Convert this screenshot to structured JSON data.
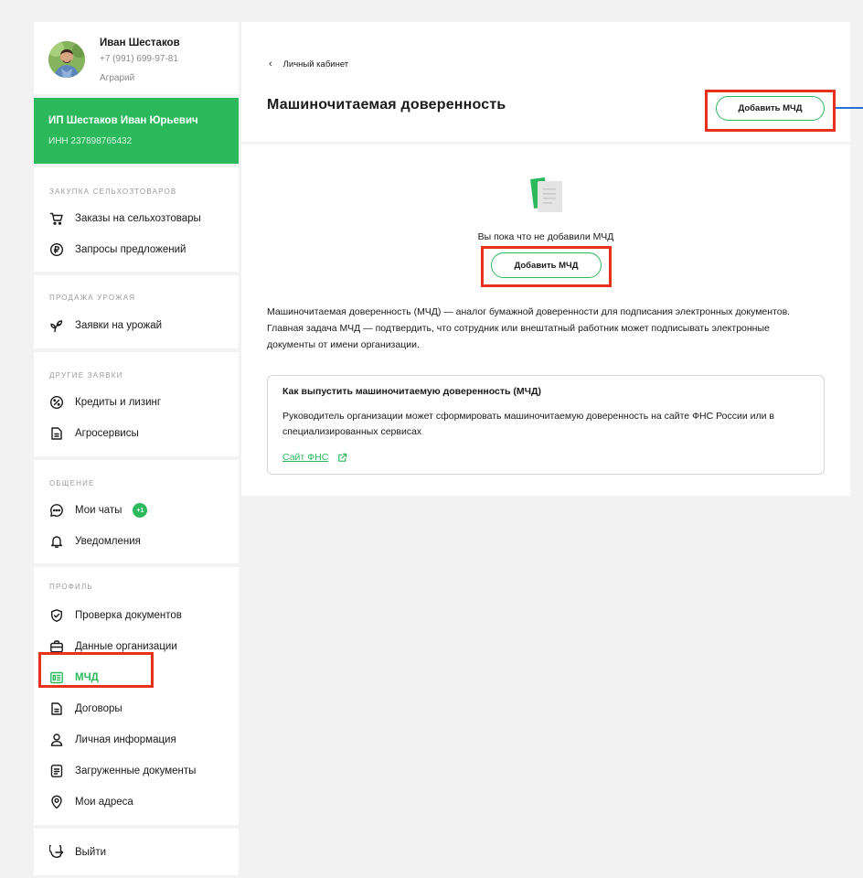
{
  "profile": {
    "name": "Иван Шестаков",
    "phone": "+7 (991) 699-97-81",
    "role": "Аграрий"
  },
  "organization": {
    "name": "ИП Шестаков Иван Юрьевич",
    "inn": "ИНН 237898765432"
  },
  "sidebar": {
    "sections": [
      {
        "title": "ЗАКУПКА СЕЛЬХОЗТОВАРОВ",
        "items": [
          {
            "label": "Заказы на сельхозтовары",
            "icon": "cart-icon"
          },
          {
            "label": "Запросы предложений",
            "icon": "ruble-icon"
          }
        ]
      },
      {
        "title": "ПРОДАЖА УРОЖАЯ",
        "items": [
          {
            "label": "Заявки на урожай",
            "icon": "sprout-icon"
          }
        ]
      },
      {
        "title": "ДРУГИЕ ЗАЯВКИ",
        "items": [
          {
            "label": "Кредиты и лизинг",
            "icon": "percent-icon"
          },
          {
            "label": "Агросервисы",
            "icon": "document-icon"
          }
        ]
      },
      {
        "title": "ОБЩЕНИЕ",
        "items": [
          {
            "label": "Мои чаты",
            "icon": "chat-icon",
            "badge": "+1"
          },
          {
            "label": "Уведомления",
            "icon": "bell-icon"
          }
        ]
      },
      {
        "title": "ПРОФИЛЬ",
        "items": [
          {
            "label": "Проверка документов",
            "icon": "shield-check-icon"
          },
          {
            "label": "Данные организации",
            "icon": "briefcase-icon"
          },
          {
            "label": "МЧД",
            "icon": "mchd-icon",
            "active": true
          },
          {
            "label": "Договоры",
            "icon": "contract-icon"
          },
          {
            "label": "Личная информация",
            "icon": "user-icon"
          },
          {
            "label": "Загруженные документы",
            "icon": "uploaded-docs-icon"
          },
          {
            "label": "Мои адреса",
            "icon": "location-pin-icon"
          }
        ]
      }
    ],
    "logout_label": "Выйти"
  },
  "header": {
    "breadcrumb": "Личный кабинет",
    "title": "Машиночитаемая доверенность",
    "add_button": "Добавить МЧД"
  },
  "main": {
    "empty_text": "Вы пока что не добавили МЧД",
    "add_button": "Добавить МЧД",
    "description": "Машиночитаемая доверенность (МЧД) — аналог бумажной доверенности для подписания электронных документов. Главная задача МЧД — подтвердить, что сотрудник или внештатный работник может подписывать электронные документы от имени организации.",
    "card": {
      "title": "Как выпустить машиночитаемую доверенность (МЧД)",
      "text": "Руководитель организации может сформировать машиночитаемую доверенность на сайте ФНС России или в специализированных сервисах",
      "link": "Сайт ФНС"
    }
  },
  "colors": {
    "accent": "#2bb95c",
    "highlight": "#e8311a",
    "connector": "#2a6fd6",
    "background": "#f2f2f2"
  }
}
